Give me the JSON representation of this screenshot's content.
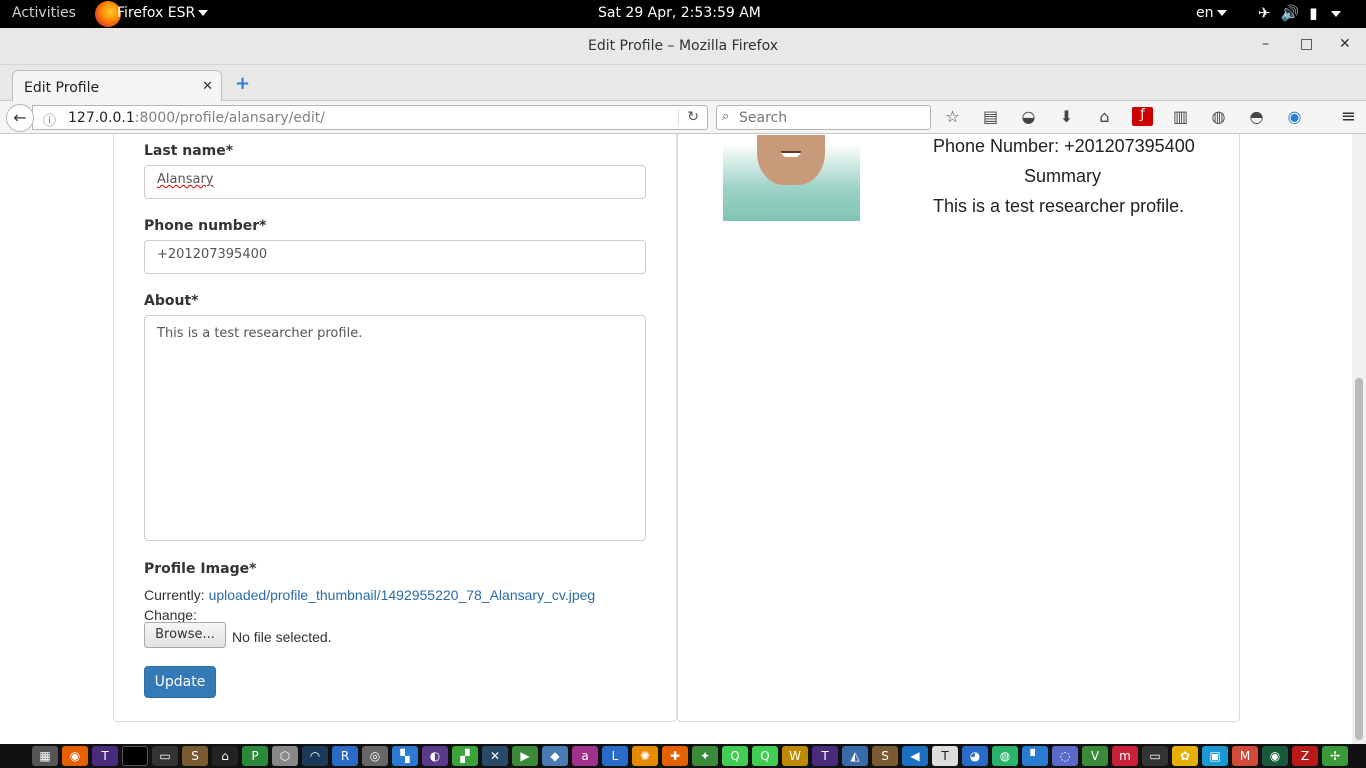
{
  "system_bar": {
    "activities": "Activities",
    "app_name": "Firefox ESR",
    "clock": "Sat 29 Apr,  2:53:59 AM",
    "language": "en"
  },
  "window": {
    "title": "Edit Profile – Mozilla Firefox",
    "minimize": "–",
    "maximize": "□",
    "close": "✕"
  },
  "tabs": [
    {
      "label": "Edit Profile",
      "close": "✕"
    }
  ],
  "new_tab": "+",
  "nav": {
    "url_host": "127.0.0.1",
    "url_rest": ":8000/profile/alansary/edit/",
    "search_placeholder": "Search"
  },
  "form": {
    "last_name_label": "Last name*",
    "last_name_value": "Alansary",
    "phone_label": "Phone number*",
    "phone_value": "+201207395400",
    "about_label": "About*",
    "about_value": "This is a test researcher profile.",
    "image_label": "Profile Image*",
    "currently_label": "Currently:",
    "currently_link": "uploaded/profile_thumbnail/1492955220_78_Alansary_cv.jpeg",
    "change_label": "Change:",
    "browse_label": "Browse...",
    "no_file": "No file selected.",
    "update_label": "Update"
  },
  "preview": {
    "phone_line": "Phone Number: +201207395400",
    "summary_heading": "Summary",
    "summary_text": "This is a test researcher profile."
  },
  "colors": {
    "primary_button": "#337ab7",
    "link": "#2a6aa8"
  }
}
